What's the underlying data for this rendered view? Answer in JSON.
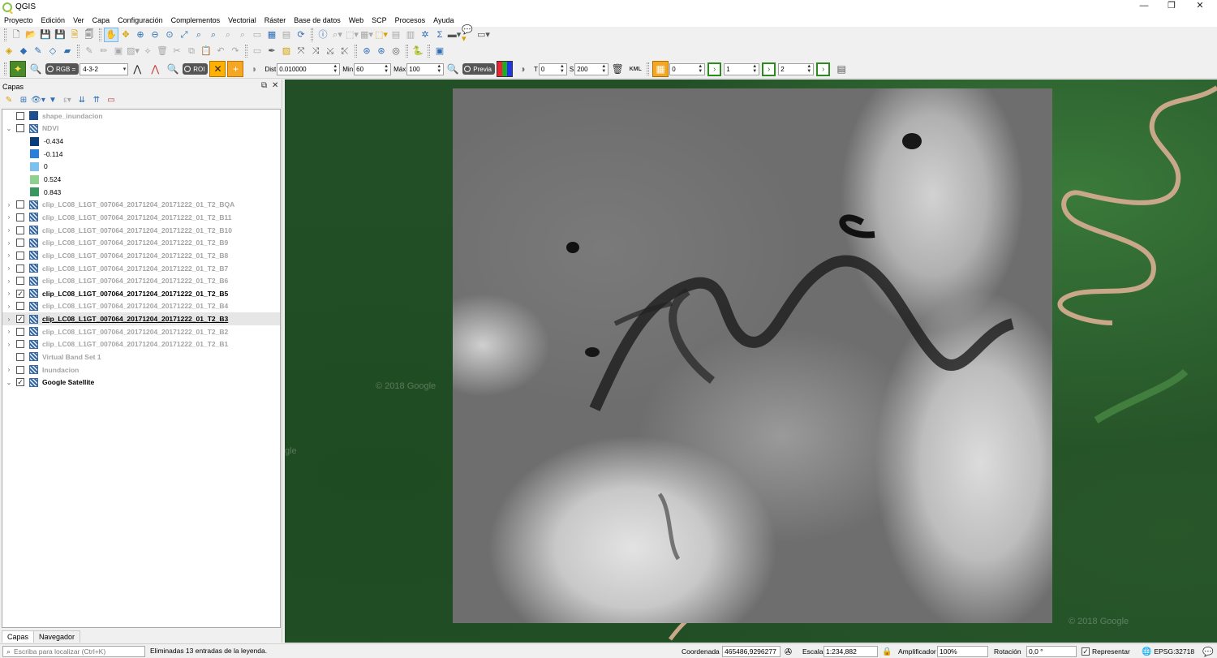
{
  "app": {
    "title": "QGIS",
    "window_controls": {
      "minimize": "—",
      "maximize": "❐",
      "close": "✕"
    }
  },
  "menu": [
    "Proyecto",
    "Edición",
    "Ver",
    "Capa",
    "Configuración",
    "Complementos",
    "Vectorial",
    "Ráster",
    "Base de datos",
    "Web",
    "SCP",
    "Procesos",
    "Ayuda"
  ],
  "scp_toolbar": {
    "rgb_label": "RGB =",
    "rgb_value": "4-3-2",
    "roi_label": "ROI",
    "dist_label": "Dist",
    "dist_value": "0.010000",
    "min_label": "Min",
    "min_value": "60",
    "max_label": "Máx",
    "max_value": "100",
    "preview_label": "Previa",
    "kml_label": "KML",
    "t_label": "T",
    "t_value": "0",
    "s_label": "S",
    "s_value": "200",
    "band1": "0",
    "band2": "1",
    "band3": "2"
  },
  "layers_panel": {
    "title": "Capas",
    "tabs": [
      "Capas",
      "Navegador"
    ],
    "layers": [
      {
        "name": "shape_inundacion",
        "checked": false,
        "style": "dim",
        "icon": "vector",
        "expander": ""
      },
      {
        "name": "NDVI",
        "checked": false,
        "style": "dim",
        "icon": "raster",
        "expander": "⌄"
      },
      {
        "name": "-0.434",
        "legend": true,
        "color": "#0b3c7a"
      },
      {
        "name": "-0.114",
        "legend": true,
        "color": "#2b7fd8"
      },
      {
        "name": "0",
        "legend": true,
        "color": "#7cc0ee"
      },
      {
        "name": "0.524",
        "legend": true,
        "color": "#8fd08f"
      },
      {
        "name": "0.843",
        "legend": true,
        "color": "#3a9560"
      },
      {
        "name": "clip_LC08_L1GT_007064_20171204_20171222_01_T2_BQA",
        "checked": false,
        "style": "dim",
        "icon": "raster",
        "expander": "›"
      },
      {
        "name": "clip_LC08_L1GT_007064_20171204_20171222_01_T2_B11",
        "checked": false,
        "style": "dim",
        "icon": "raster",
        "expander": "›"
      },
      {
        "name": "clip_LC08_L1GT_007064_20171204_20171222_01_T2_B10",
        "checked": false,
        "style": "dim",
        "icon": "raster",
        "expander": "›"
      },
      {
        "name": "clip_LC08_L1GT_007064_20171204_20171222_01_T2_B9",
        "checked": false,
        "style": "dim",
        "icon": "raster",
        "expander": "›"
      },
      {
        "name": "clip_LC08_L1GT_007064_20171204_20171222_01_T2_B8",
        "checked": false,
        "style": "dim",
        "icon": "raster",
        "expander": "›"
      },
      {
        "name": "clip_LC08_L1GT_007064_20171204_20171222_01_T2_B7",
        "checked": false,
        "style": "dim",
        "icon": "raster",
        "expander": "›"
      },
      {
        "name": "clip_LC08_L1GT_007064_20171204_20171222_01_T2_B6",
        "checked": false,
        "style": "dim",
        "icon": "raster",
        "expander": "›"
      },
      {
        "name": "clip_LC08_L1GT_007064_20171204_20171222_01_T2_B5",
        "checked": true,
        "style": "bold",
        "icon": "raster",
        "expander": "›"
      },
      {
        "name": "clip_LC08_L1GT_007064_20171204_20171222_01_T2_B4",
        "checked": false,
        "style": "dim",
        "icon": "raster",
        "expander": "›"
      },
      {
        "name": "clip_LC08_L1GT_007064_20171204_20171222_01_T2_B3",
        "checked": true,
        "style": "bold-underline",
        "icon": "raster",
        "expander": "›",
        "selected": true
      },
      {
        "name": "clip_LC08_L1GT_007064_20171204_20171222_01_T2_B2",
        "checked": false,
        "style": "dim",
        "icon": "raster",
        "expander": "›"
      },
      {
        "name": "clip_LC08_L1GT_007064_20171204_20171222_01_T2_B1",
        "checked": false,
        "style": "dim",
        "icon": "raster",
        "expander": "›"
      },
      {
        "name": "Virtual Band Set 1",
        "checked": false,
        "style": "dim",
        "icon": "raster",
        "expander": ""
      },
      {
        "name": "Inundacion",
        "checked": false,
        "style": "dim",
        "icon": "raster",
        "expander": "›"
      },
      {
        "name": "Google Satellite",
        "checked": true,
        "style": "bold",
        "icon": "raster",
        "expander": "⌄"
      }
    ]
  },
  "map": {
    "watermarks": [
      "© 2018 Google",
      "© 2018 Google",
      "gle"
    ]
  },
  "status": {
    "locator_placeholder": "Escriba para localizar (Ctrl+K)",
    "message": "Eliminadas 13 entradas de la leyenda.",
    "coord_label": "Coordenada",
    "coord_value": "465486,9296277",
    "scale_label": "Escala",
    "scale_value": "1:234,882",
    "magnifier_label": "Amplificador",
    "magnifier_value": "100%",
    "rotation_label": "Rotación",
    "rotation_value": "0,0 °",
    "render_label": "Representar",
    "epsg": "EPSG:32718"
  }
}
